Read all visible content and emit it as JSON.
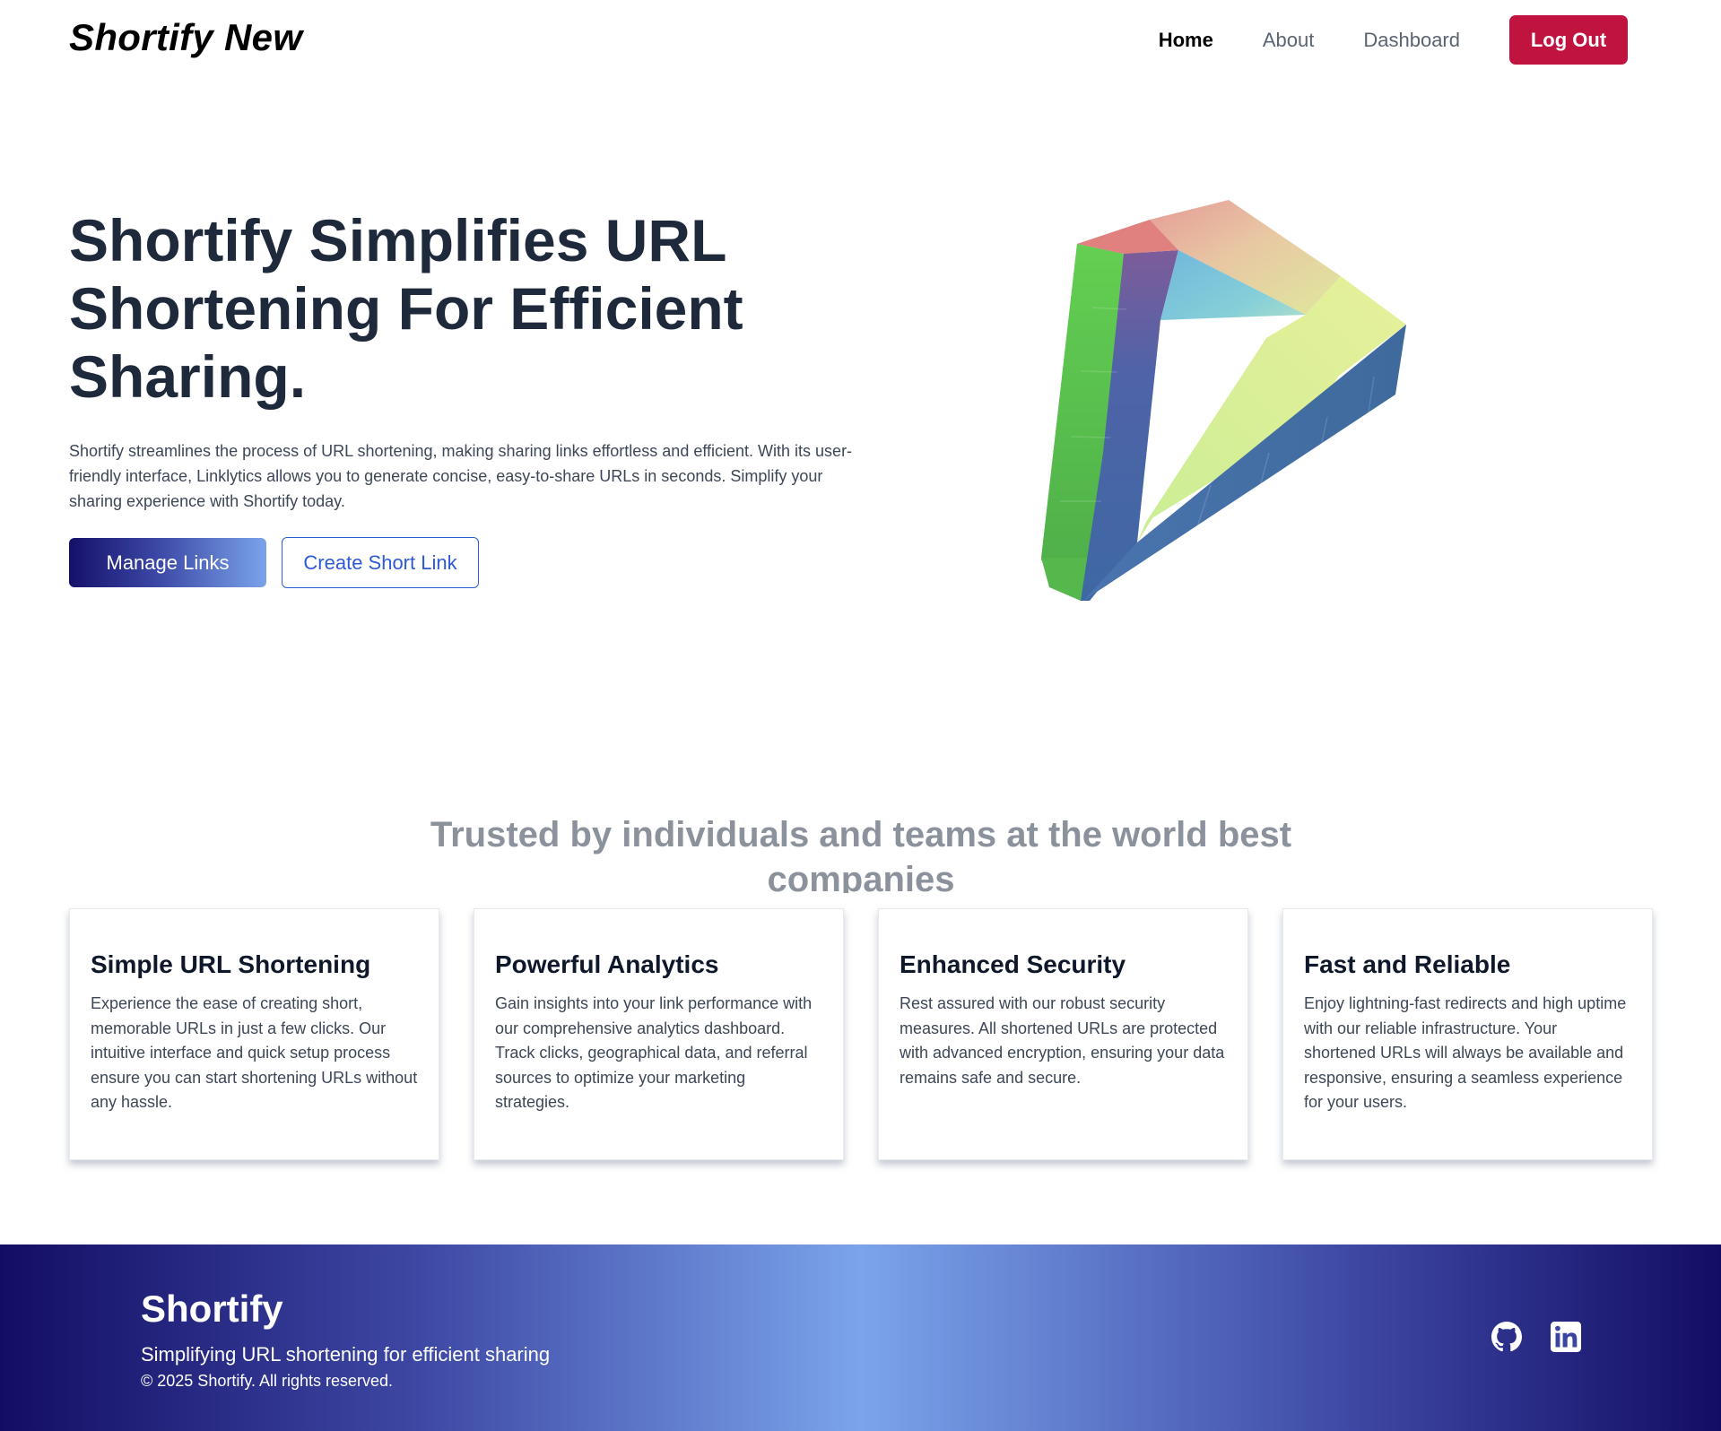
{
  "nav": {
    "brand": "Shortify New",
    "links": {
      "home": "Home",
      "about": "About",
      "dashboard": "Dashboard"
    },
    "logout": "Log Out"
  },
  "hero": {
    "title": "Shortify Simplifies URL Shortening For Efficient Sharing.",
    "description": "Shortify streamlines the process of URL shortening, making sharing links effortless and efficient. With its user-friendly interface, Linklytics allows you to generate concise, easy-to-share URLs in seconds. Simplify your sharing experience with Shortify today.",
    "primary_button": "Manage Links",
    "secondary_button": "Create Short Link",
    "illustration": "impossible-triangle-3d"
  },
  "trusted": {
    "heading": "Trusted by individuals and teams at the world best companies"
  },
  "features": [
    {
      "title": "Simple URL Shortening",
      "text": "Experience the ease of creating short, memorable URLs in just a few clicks. Our intuitive interface and quick setup process ensure you can start shortening URLs without any hassle."
    },
    {
      "title": "Powerful Analytics",
      "text": "Gain insights into your link performance with our comprehensive analytics dashboard. Track clicks, geographical data, and referral sources to optimize your marketing strategies."
    },
    {
      "title": "Enhanced Security",
      "text": "Rest assured with our robust security measures. All shortened URLs are protected with advanced encryption, ensuring your data remains safe and secure."
    },
    {
      "title": "Fast and Reliable",
      "text": "Enjoy lightning-fast redirects and high uptime with our reliable infrastructure. Your shortened URLs will always be available and responsive, ensuring a seamless experience for your users."
    }
  ],
  "footer": {
    "brand": "Shortify",
    "tagline": "Simplifying URL shortening for efficient sharing",
    "copyright": "© 2025 Shortify. All rights reserved.",
    "icons": [
      "github-icon",
      "linkedin-icon"
    ]
  },
  "colors": {
    "logout_bg": "#c0133f",
    "accent_blue": "#2f5ad7",
    "heading": "#1e293b",
    "footer_dark": "#130d64",
    "footer_light": "#7ba4eb"
  }
}
